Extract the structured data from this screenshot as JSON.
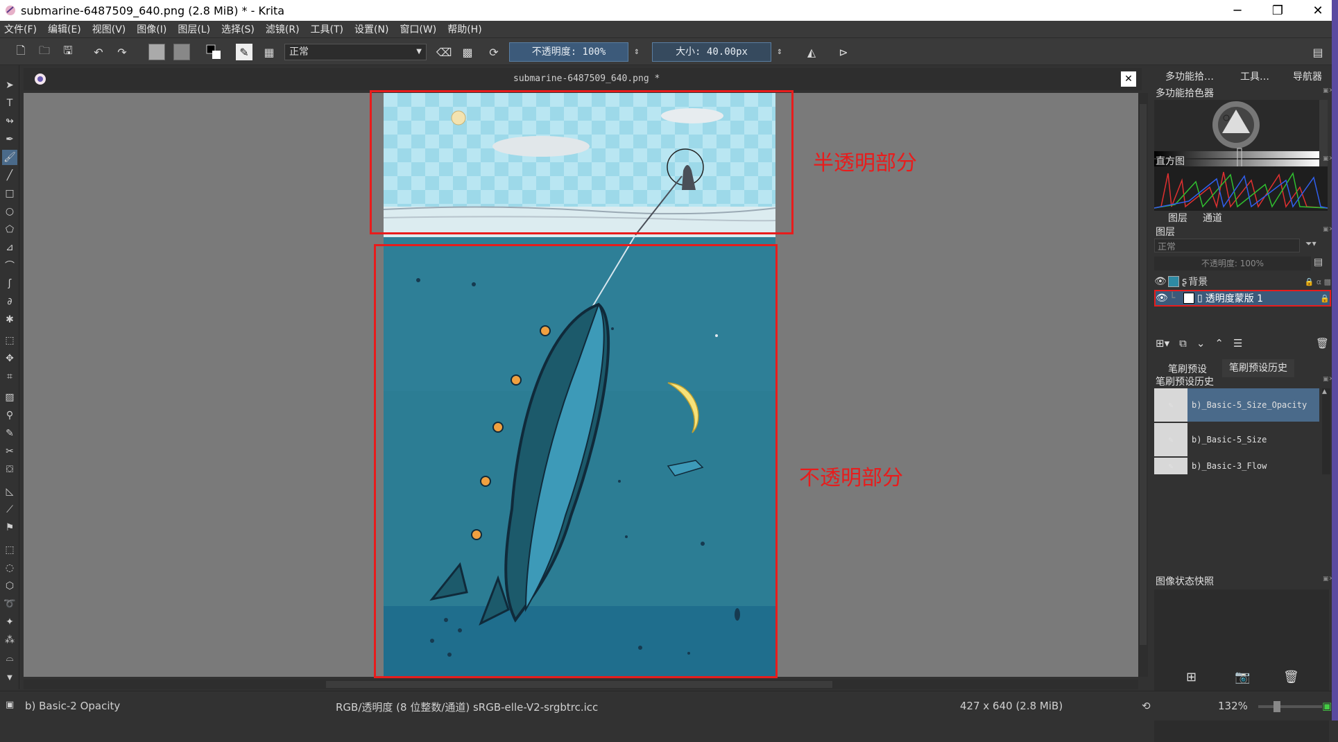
{
  "window": {
    "title": "submarine-6487509_640.png (2.8 MiB)  * - Krita",
    "minimize": "─",
    "maximize": "❐",
    "close": "✕"
  },
  "menu": [
    "文件(F)",
    "编辑(E)",
    "视图(V)",
    "图像(I)",
    "图层(L)",
    "选择(S)",
    "滤镜(R)",
    "工具(T)",
    "设置(N)",
    "窗口(W)",
    "帮助(H)"
  ],
  "toolbar": {
    "blend_mode": "正常",
    "opacity_label": "不透明度: 100%",
    "size_label": "大小: 40.00px"
  },
  "document": {
    "tab_title": "submarine-6487509_640.png *"
  },
  "annotations": {
    "top_label": "半透明部分",
    "bottom_label": "不透明部分"
  },
  "dock": {
    "tabs": [
      "多功能拾…",
      "工具…",
      "导航器"
    ],
    "color_selector_title": "多功能拾色器",
    "histogram_title": "直方图",
    "layer_tabs": [
      "图层",
      "通道"
    ],
    "layers_title": "图层",
    "layer_blend": "正常",
    "layer_opacity": "不透明度: 100%",
    "layers": [
      {
        "name": "背景",
        "selected": false
      },
      {
        "name": "透明度蒙版 1",
        "selected": true
      }
    ],
    "brush_tabs": [
      "笔刷预设",
      "笔刷预设历史"
    ],
    "brush_history_title": "笔刷预设历史",
    "brush_history": [
      {
        "name": "b)_Basic-5_Size_Opacity",
        "selected": true
      },
      {
        "name": "b)_Basic-5_Size",
        "selected": false
      },
      {
        "name": "b)_Basic-3_Flow",
        "selected": false
      }
    ],
    "snapshot_title": "图像状态快照"
  },
  "status": {
    "brush": "b) Basic-2 Opacity",
    "color_space": "RGB/透明度 (8 位整数/通道)  sRGB-elle-V2-srgbtrc.icc",
    "dimensions": "427 x 640 (2.8 MiB)",
    "zoom": "132%"
  },
  "colors": {
    "annotation_red": "#e81c1c",
    "sky": "#8fd6e8",
    "sea": "#2e8aa3",
    "accent": "#4a6a8a"
  }
}
